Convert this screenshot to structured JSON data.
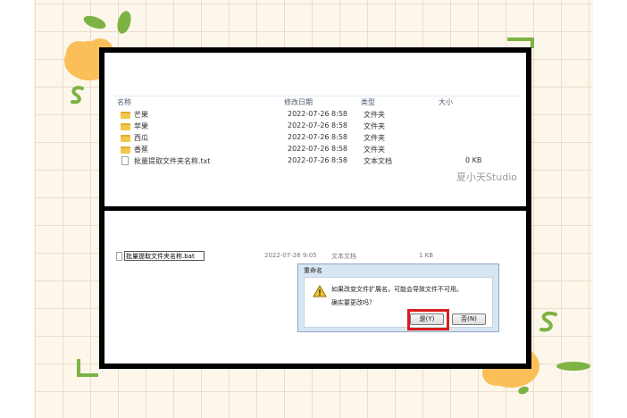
{
  "top_panel": {
    "columns": {
      "name": "名称",
      "modified": "修改日期",
      "type": "类型",
      "size": "大小"
    },
    "rows": [
      {
        "icon": "folder-icon",
        "name": "芒果",
        "modified": "2022-07-26 8:58",
        "type": "文件夹",
        "size": ""
      },
      {
        "icon": "folder-icon",
        "name": "苹果",
        "modified": "2022-07-26 8:58",
        "type": "文件夹",
        "size": ""
      },
      {
        "icon": "folder-icon",
        "name": "西瓜",
        "modified": "2022-07-26 8:58",
        "type": "文件夹",
        "size": ""
      },
      {
        "icon": "folder-icon",
        "name": "香蕉",
        "modified": "2022-07-26 8:58",
        "type": "文件夹",
        "size": ""
      },
      {
        "icon": "text-file-icon",
        "name": "批量提取文件夹名称.txt",
        "modified": "2022-07-26 8:58",
        "type": "文本文档",
        "size": "0 KB"
      }
    ],
    "watermark": "夏小天Studio"
  },
  "bottom_panel": {
    "file_row": {
      "name": "批量提取文件夹名称.bat",
      "modified": "2022-07-26 9:05",
      "type": "文本文档",
      "size": "1 KB"
    },
    "dialog": {
      "title": "重命名",
      "message": "如果改变文件扩展名，可能会导致文件不可用。",
      "question": "确实要更改吗？",
      "yes_label": "是(Y)",
      "no_label": "否(N)",
      "icon": "warning-icon"
    }
  },
  "colors": {
    "highlight": "#d81e1e",
    "frame": "#000000",
    "dialog_bg": "#d8e6f3",
    "folder": "#f2c84b",
    "decor_green": "#7cb342",
    "decor_orange": "#f9b54c"
  }
}
